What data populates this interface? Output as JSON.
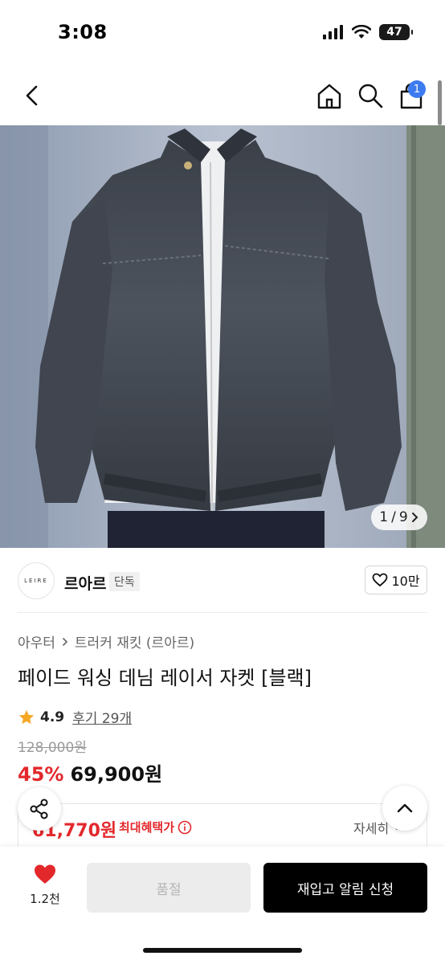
{
  "status_bar": {
    "time": "3:08",
    "battery": "47"
  },
  "nav": {
    "cart_count": "1"
  },
  "gallery": {
    "current": "1",
    "separator": "/",
    "total": "9"
  },
  "brand": {
    "logo_text": "LEIRE",
    "name": "르아르",
    "tag": "단독",
    "likes": "10만"
  },
  "breadcrumb": {
    "category": "아우터",
    "sub": "트러커 재킷 (르아르)"
  },
  "product": {
    "title": "페이드 워싱 데님 레이서 자켓 [블랙]",
    "rating": "4.9",
    "reviews": "후기 29개",
    "original_price": "128,000원",
    "discount": "45%",
    "sale_price": "69,900원"
  },
  "benefit": {
    "price": "61,770원",
    "label": "최대혜택가",
    "detail": "자세히"
  },
  "bottom_bar": {
    "wish_count": "1.2천",
    "option_label": "품절",
    "restock_label": "재입고 알림 신청"
  },
  "colors": {
    "accent": "#e3282c",
    "badge": "#3d7bf0"
  }
}
